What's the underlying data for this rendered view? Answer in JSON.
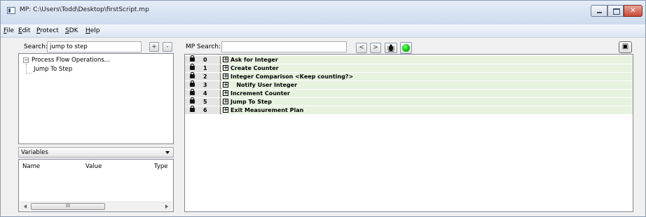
{
  "window": {
    "title": "MP: C:\\Users\\Todd\\Desktop\\firstScript.mp",
    "close_glyph": "✕"
  },
  "menu": {
    "items": [
      {
        "label": "File"
      },
      {
        "label": "Edit"
      },
      {
        "label": "Protect"
      },
      {
        "label": "SDK"
      },
      {
        "label": "Help"
      }
    ]
  },
  "left": {
    "search_label": "Search:",
    "search_value": "jump to step",
    "add_label": "+",
    "remove_label": "-",
    "tree": {
      "root": "Process Flow Operations...",
      "child": "Jump To Step",
      "toggle_glyph": "−"
    },
    "variables": {
      "dropdown_value": "Variables",
      "columns": [
        "Name",
        "Value",
        "Type"
      ],
      "scroll_thumb_glyph": "III"
    }
  },
  "mp": {
    "search_label": "MP Search:",
    "search_value": "",
    "prev_label": "<",
    "next_label": ">",
    "debug_icon": "bug-icon",
    "status_color": "#00c000",
    "right_button_glyph": "▣"
  },
  "steps": [
    {
      "num": "0",
      "name": "Ask for Integer"
    },
    {
      "num": "1",
      "name": "Create Counter"
    },
    {
      "num": "2",
      "name": "Integer Comparison   <Keep counting?>"
    },
    {
      "num": "3",
      "name": "   Notify User Integer"
    },
    {
      "num": "4",
      "name": "Increment Counter"
    },
    {
      "num": "5",
      "name": "Jump To Step"
    },
    {
      "num": "6",
      "name": "Exit Measurement Plan"
    }
  ],
  "colors": {
    "row_body": "#e7f2df",
    "gutter": "#e4e4e4"
  }
}
